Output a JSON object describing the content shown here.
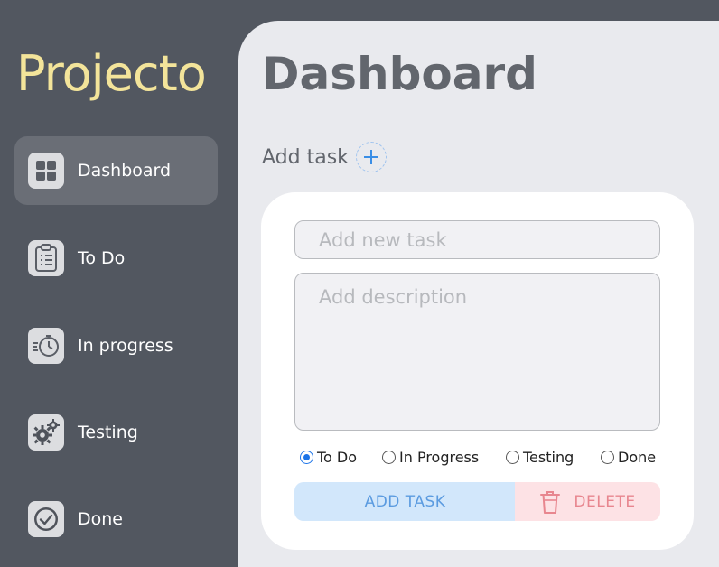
{
  "app": {
    "logo": "Projecto"
  },
  "sidebar": {
    "items": [
      {
        "label": "Dashboard",
        "icon": "dashboard-grid-icon",
        "active": true
      },
      {
        "label": "To Do",
        "icon": "clipboard-checklist-icon",
        "active": false
      },
      {
        "label": "In progress",
        "icon": "stopwatch-icon",
        "active": false
      },
      {
        "label": "Testing",
        "icon": "gears-icon",
        "active": false
      },
      {
        "label": "Done",
        "icon": "check-circle-icon",
        "active": false
      }
    ]
  },
  "main": {
    "title": "Dashboard",
    "add_task_label": "Add task",
    "add_task_icon": "plus-icon",
    "form": {
      "title_placeholder": "Add new task",
      "title_value": "",
      "description_placeholder": "Add description",
      "description_value": "",
      "status_options": [
        "To Do",
        "In Progress",
        "Testing",
        "Done"
      ],
      "selected_status": "To Do",
      "add_button": "ADD TASK",
      "delete_button": "DELETE",
      "delete_icon": "trash-icon"
    }
  },
  "colors": {
    "sidebar_bg": "#525760",
    "main_bg": "#e9eaee",
    "logo": "#f3e49a",
    "accent_blue": "#3a8ee6",
    "add_btn_bg": "#d2e7fb",
    "delete_btn_bg": "#fde2e5",
    "delete_text": "#e8868f"
  }
}
